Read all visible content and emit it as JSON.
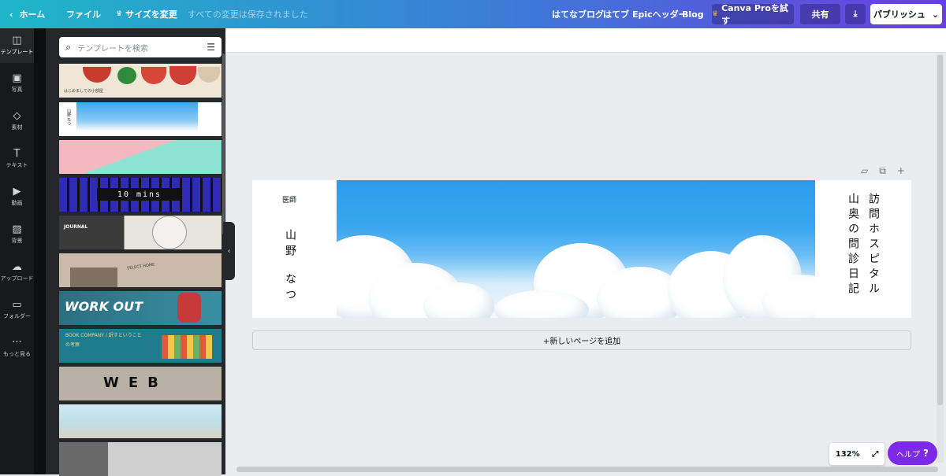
{
  "topbar": {
    "home": "ホーム",
    "file": "ファイル",
    "resize": "サイズを変更",
    "saved": "すべての変更は保存されました",
    "links": [
      "はてなブログ",
      "はてブ",
      "Epicヘッダー",
      "Blog"
    ],
    "pro": "Canva Proを試す",
    "share": "共有",
    "publish": "パブリッシュ",
    "colors": {
      "gradient_start": "#1fb6c9",
      "gradient_end": "#6a3fe0"
    }
  },
  "sidebar": {
    "items": [
      {
        "label": "テンプレート",
        "icon": "templates-icon"
      },
      {
        "label": "写真",
        "icon": "photo-icon"
      },
      {
        "label": "素材",
        "icon": "elements-icon"
      },
      {
        "label": "テキスト",
        "icon": "text-icon"
      },
      {
        "label": "動画",
        "icon": "video-icon"
      },
      {
        "label": "背景",
        "icon": "background-icon"
      },
      {
        "label": "アップロード",
        "icon": "upload-icon"
      },
      {
        "label": "フォルダー",
        "icon": "folder-icon"
      },
      {
        "label": "もっと見る",
        "icon": "more-icon"
      }
    ]
  },
  "panel": {
    "search_placeholder": "テンプレートを検索",
    "templates": [
      {
        "text": "はじめましての小部屋",
        "bg": "#efe6d6"
      },
      {
        "text": "山野 なつ",
        "bg": "#ffffff"
      },
      {
        "text": "",
        "bg": "#f6b8c0"
      },
      {
        "text": "10 mins",
        "bg": "#2f2bb5"
      },
      {
        "text": "JOURNAL",
        "bg": "#d8d4cc"
      },
      {
        "text": "SELECT HOME",
        "bg": "#c9bba7"
      },
      {
        "text": "WORK OUT",
        "bg": "#3a8fa3"
      },
      {
        "text": "BOOK COMPANY / 訳すということの考察",
        "bg": "#1f7c8f"
      },
      {
        "text": "WEB",
        "bg": "#b9b1a6"
      },
      {
        "text": "",
        "bg": "#bfe0ea"
      },
      {
        "text": "",
        "bg": "#9a9a9a"
      }
    ]
  },
  "canvas": {
    "left_role": "医師",
    "left_name_1": "山野",
    "left_name_2": "なつ",
    "right_title_1": "訪問ホスピタル",
    "right_title_2": "山奥の問診日記",
    "add_page": "+新しいページを追加"
  },
  "footer": {
    "zoom": "132%",
    "help": "ヘルプ",
    "help_mark": "?"
  }
}
